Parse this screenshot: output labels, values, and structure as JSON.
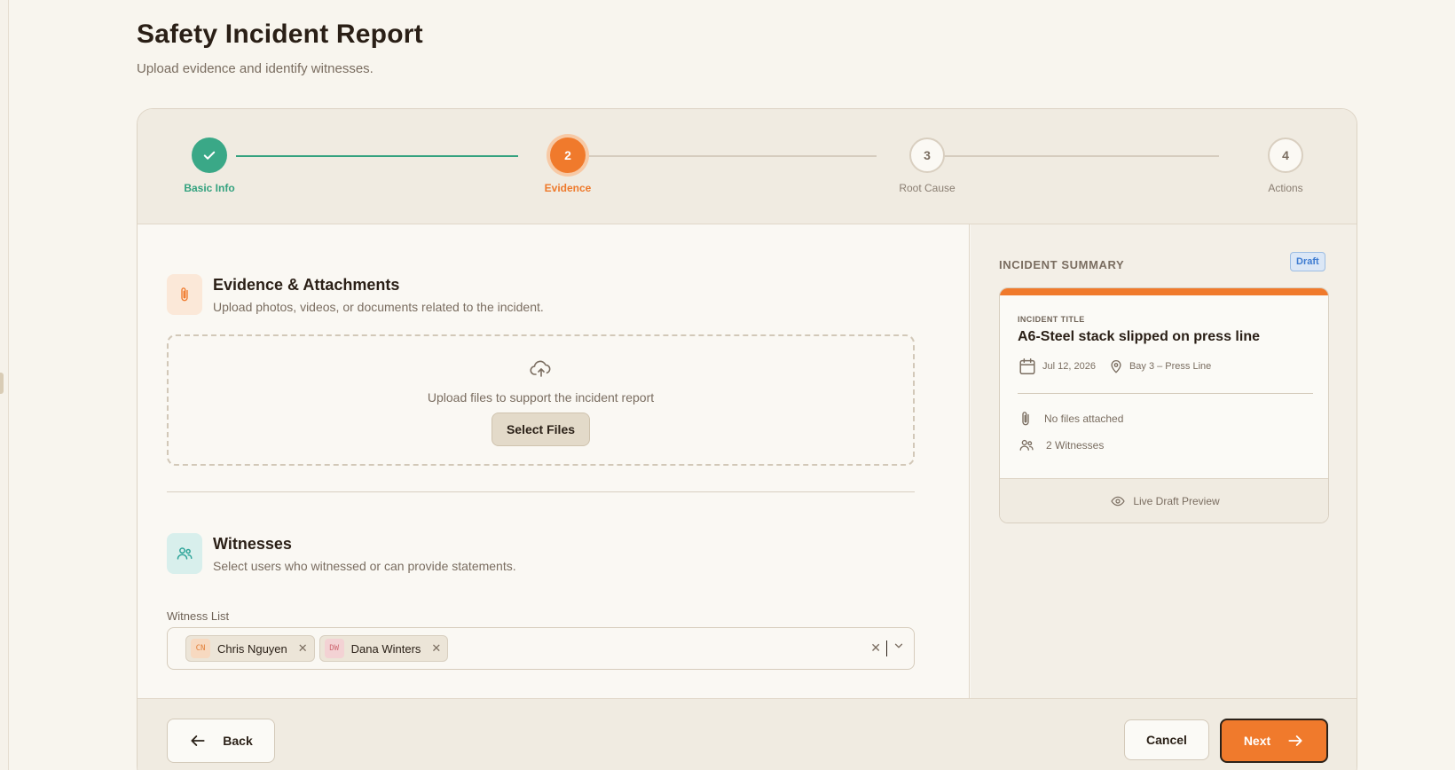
{
  "page": {
    "title": "Safety Incident Report",
    "subtitle": "Upload evidence and identify witnesses."
  },
  "stepper": {
    "steps": [
      {
        "number": "1",
        "label": "Basic Info",
        "state": "done"
      },
      {
        "number": "2",
        "label": "Evidence",
        "state": "active"
      },
      {
        "number": "3",
        "label": "Root Cause",
        "state": "todo"
      },
      {
        "number": "4",
        "label": "Actions",
        "state": "todo"
      }
    ]
  },
  "evidence": {
    "icon": "paperclip-icon",
    "title": "Evidence & Attachments",
    "description": "Upload photos, videos, or documents related to the incident.",
    "upload_text": "Upload files to support the incident report",
    "select_files_label": "Select Files"
  },
  "witnesses": {
    "icon": "users-icon",
    "title": "Witnesses",
    "description": "Select users who witnessed or can provide statements.",
    "field_label": "Witness List",
    "selected": [
      {
        "initials": "CN",
        "name": "Chris Nguyen"
      },
      {
        "initials": "DW",
        "name": "Dana Winters"
      }
    ]
  },
  "summary": {
    "heading": "INCIDENT SUMMARY",
    "badge": "Draft",
    "kicker": "INCIDENT TITLE",
    "incident_title": "A6-Steel stack slipped on press line",
    "date": "Jul 12, 2026",
    "location": "Bay 3 – Press Line",
    "files": "No files attached",
    "witnesses": "2 Witnesses",
    "footer": "Live Draft Preview"
  },
  "footer": {
    "back_label": "Back",
    "cancel_label": "Cancel",
    "next_label": "Next"
  },
  "colors": {
    "accent": "#f07a2c",
    "success": "#34a27f",
    "info": "#3d7bd0"
  }
}
